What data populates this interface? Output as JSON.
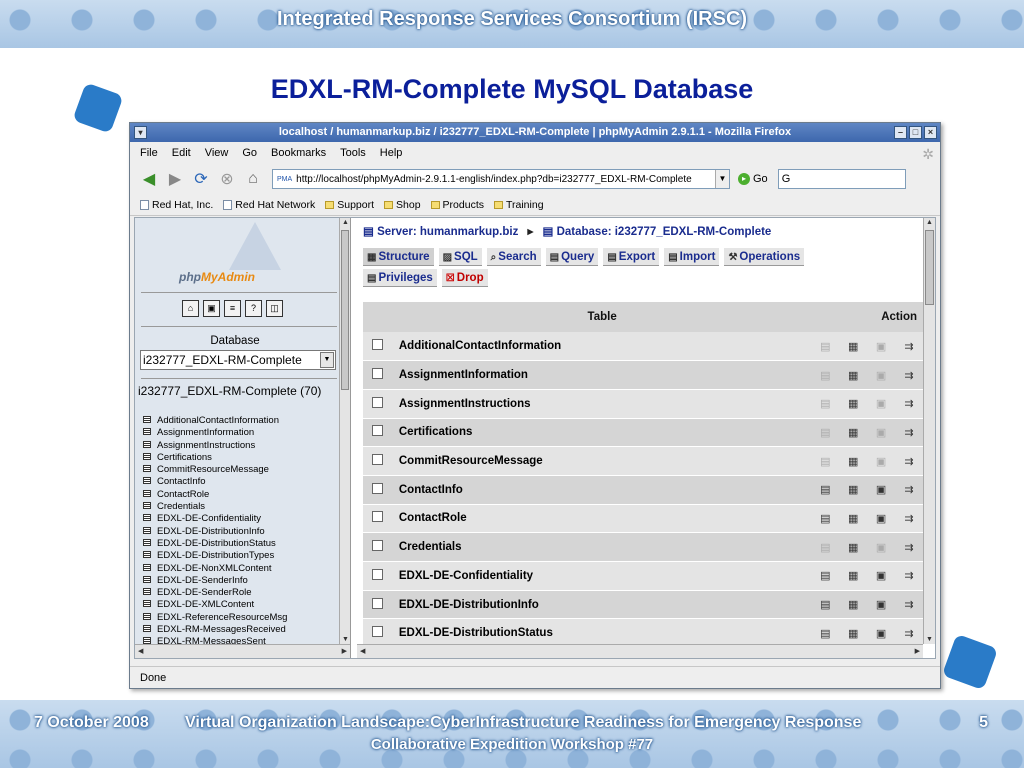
{
  "slide": {
    "header": "Integrated Response Services Consortium (IRSC)",
    "title": "EDXL-RM-Complete MySQL Database",
    "footer_date": "7 October 2008",
    "footer_center": "Virtual Organization Landscape:CyberInfrastructure Readiness for Emergency Response",
    "footer_page": "5",
    "footer_sub": "Collaborative Expedition Workshop #77"
  },
  "browser": {
    "window_title": "localhost / humanmarkup.biz / i232777_EDXL-RM-Complete | phpMyAdmin 2.9.1.1 - Mozilla Firefox",
    "menu": [
      "File",
      "Edit",
      "View",
      "Go",
      "Bookmarks",
      "Tools",
      "Help"
    ],
    "url": "http://localhost/phpMyAdmin-2.9.1.1-english/index.php?db=i232777_EDXL-RM-Complete",
    "go_label": "Go",
    "search_value": "G",
    "bookmarks": [
      {
        "label": "Red Hat, Inc.",
        "icon": "page"
      },
      {
        "label": "Red Hat Network",
        "icon": "page"
      },
      {
        "label": "Support",
        "icon": "folder"
      },
      {
        "label": "Shop",
        "icon": "folder"
      },
      {
        "label": "Products",
        "icon": "folder"
      },
      {
        "label": "Training",
        "icon": "folder"
      }
    ],
    "status": "Done"
  },
  "left_frame": {
    "logo_php": "php",
    "logo_myadmin": "MyAdmin",
    "database_label": "Database",
    "database_selected": "i232777_EDXL-RM-Complete",
    "database_count": "i232777_EDXL-RM-Complete (70)",
    "tables": [
      "AdditionalContactInformation",
      "AssignmentInformation",
      "AssignmentInstructions",
      "Certifications",
      "CommitResourceMessage",
      "ContactInfo",
      "ContactRole",
      "Credentials",
      "EDXL-DE-Confidentiality",
      "EDXL-DE-DistributionInfo",
      "EDXL-DE-DistributionStatus",
      "EDXL-DE-DistributionTypes",
      "EDXL-DE-NonXMLContent",
      "EDXL-DE-SenderInfo",
      "EDXL-DE-SenderRole",
      "EDXL-DE-XMLContent",
      "EDXL-ReferenceResourceMsg",
      "EDXL-RM-MessagesReceived",
      "EDXL-RM-MessagesSent"
    ]
  },
  "right_frame": {
    "server_label": "Server: humanmarkup.biz",
    "database_label": "Database: i232777_EDXL-RM-Complete",
    "tabs_row1": [
      "Structure",
      "SQL",
      "Search",
      "Query",
      "Export",
      "Import",
      "Operations"
    ],
    "tabs_row2": [
      "Privileges",
      "Drop"
    ],
    "col_table": "Table",
    "col_action": "Action",
    "rows": [
      {
        "name": "AdditionalContactInformation",
        "browse_active": false
      },
      {
        "name": "AssignmentInformation",
        "browse_active": false
      },
      {
        "name": "AssignmentInstructions",
        "browse_active": false
      },
      {
        "name": "Certifications",
        "browse_active": false
      },
      {
        "name": "CommitResourceMessage",
        "browse_active": false
      },
      {
        "name": "ContactInfo",
        "browse_active": true
      },
      {
        "name": "ContactRole",
        "browse_active": true
      },
      {
        "name": "Credentials",
        "browse_active": false
      },
      {
        "name": "EDXL-DE-Confidentiality",
        "browse_active": true
      },
      {
        "name": "EDXL-DE-DistributionInfo",
        "browse_active": true
      },
      {
        "name": "EDXL-DE-DistributionStatus",
        "browse_active": true
      }
    ]
  }
}
